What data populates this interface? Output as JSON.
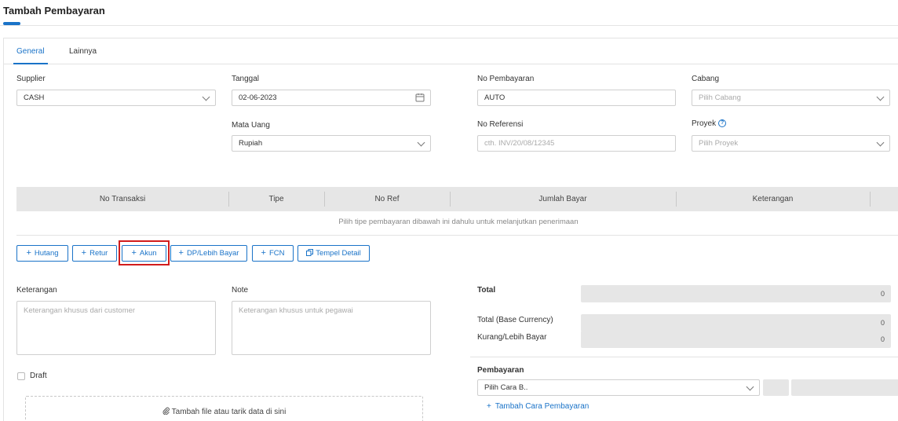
{
  "page": {
    "title": "Tambah Pembayaran"
  },
  "tabs": [
    {
      "label": "General"
    },
    {
      "label": "Lainnya"
    }
  ],
  "form": {
    "supplier": {
      "label": "Supplier",
      "value": "CASH"
    },
    "tanggal": {
      "label": "Tanggal",
      "value": "02-06-2023"
    },
    "no_pembayaran": {
      "label": "No Pembayaran",
      "value": "AUTO"
    },
    "cabang": {
      "label": "Cabang",
      "placeholder": "Pilih Cabang"
    },
    "mata_uang": {
      "label": "Mata Uang",
      "value": "Rupiah"
    },
    "no_referensi": {
      "label": "No Referensi",
      "placeholder": "cth. INV/20/08/12345"
    },
    "proyek": {
      "label": "Proyek",
      "placeholder": "Pilih Proyek"
    }
  },
  "table": {
    "headers": [
      "No Transaksi",
      "Tipe",
      "No Ref",
      "Jumlah Bayar",
      "Keterangan"
    ],
    "empty_message": "Pilih tipe pembayaran dibawah ini dahulu untuk melanjutkan penerimaan"
  },
  "buttons": {
    "hutang": "Hutang",
    "retur": "Retur",
    "akun": "Akun",
    "dp": "DP/Lebih Bayar",
    "fcn": "FCN",
    "tempel": "Tempel Detail"
  },
  "notes": {
    "keterangan": {
      "label": "Keterangan",
      "placeholder": "Keterangan khusus dari customer"
    },
    "note": {
      "label": "Note",
      "placeholder": "Keterangan khusus untuk pegawai"
    }
  },
  "draft": {
    "label": "Draft"
  },
  "upload": {
    "label": "Tambah file atau tarik data di sini"
  },
  "summary": {
    "total": {
      "label": "Total",
      "value": "0"
    },
    "total_base": {
      "label": "Total (Base Currency)",
      "value": "0"
    },
    "kurang": {
      "label": "Kurang/Lebih Bayar",
      "value": "0"
    }
  },
  "payment": {
    "label": "Pembayaran",
    "method_placeholder": "Pilih Cara B..",
    "add_link": "Tambah Cara Pembayaran"
  },
  "colors": {
    "accent": "#1a73c8",
    "highlight": "#d21c1c",
    "header_bg": "#e6e6e6"
  },
  "icons": [
    "calendar-icon",
    "chevron-down-icon",
    "help-icon",
    "plus-icon",
    "copy-icon",
    "paperclip-icon"
  ]
}
